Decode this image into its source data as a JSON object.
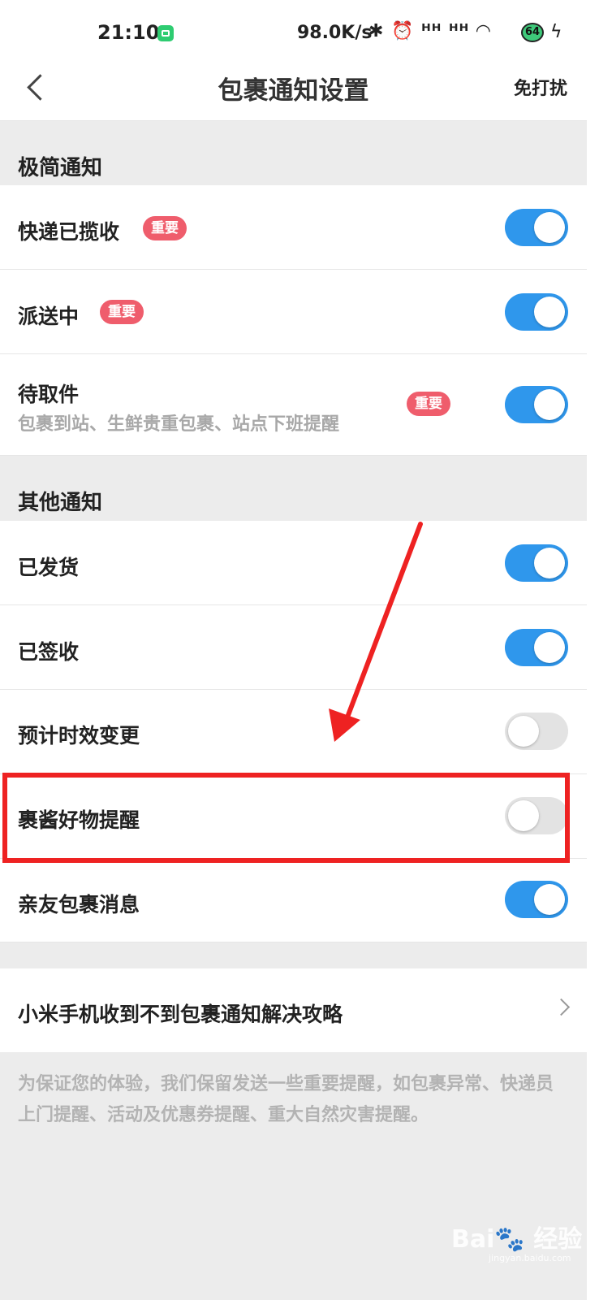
{
  "status_bar": {
    "time": "21:10",
    "net_speed": "98.0K/s",
    "icons_text": "✱ ⏰ ᵸᵸ ᵸᵸ ◠",
    "battery": "64",
    "icons": [
      "app-icon",
      "bluetooth-icon",
      "alarm-icon",
      "signal-icon",
      "signal-icon",
      "wifi-icon",
      "battery-icon",
      "charging-icon"
    ]
  },
  "header": {
    "title": "包裹通知设置",
    "dnd_label": "免打扰"
  },
  "sections": {
    "simple": "极简通知",
    "other": "其他通知"
  },
  "badge_text": "重要",
  "rows": {
    "collected": {
      "label": "快递已揽收",
      "on": true
    },
    "delivering": {
      "label": "派送中",
      "on": true
    },
    "pickup": {
      "label": "待取件",
      "sub": "包裹到站、生鲜贵重包裹、站点下班提醒",
      "on": true
    },
    "shipped": {
      "label": "已发货",
      "on": true
    },
    "signed": {
      "label": "已签收",
      "on": true
    },
    "eta_change": {
      "label": "预计时效变更",
      "on": false
    },
    "goods_reminder": {
      "label": "裹酱好物提醒",
      "on": false
    },
    "family": {
      "label": "亲友包裹消息",
      "on": true
    }
  },
  "guide_link": "小米手机收到不到包裹通知解决攻略",
  "footnote": "为保证您的体验，我们保留发送一些重要提醒，如包裹异常、快递员上门提醒、活动及优惠券提醒、重大自然灾害提醒。",
  "watermark": {
    "text": "Bai🐾 经验",
    "sub": "jingyan.baidu.com"
  },
  "colors": {
    "toggle_on": "#2f97ec",
    "toggle_off": "#e3e3e3",
    "badge": "#ef5d6c",
    "annotation_red": "#ee2222"
  }
}
